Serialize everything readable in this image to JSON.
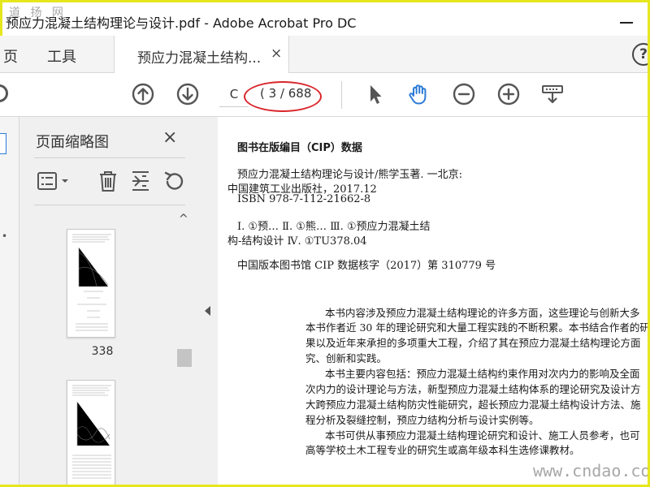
{
  "window": {
    "title": "预应力混凝土结构理论与设计.pdf - Adobe Acrobat Pro DC",
    "watermark_top": "道 扬 网"
  },
  "menubar": {
    "home_partial": "页",
    "tools": "工具",
    "tab_label": "预应力混凝土结构...",
    "tab_close": "×",
    "help": "?"
  },
  "toolbar": {
    "page_input_value": "C",
    "page_count": "( 3 / 688",
    "icons": [
      "search-icon",
      "arrow-up-circle-icon",
      "arrow-down-circle-icon",
      "pointer-icon",
      "hand-icon",
      "zoom-out-icon",
      "zoom-in-icon",
      "tools-icon"
    ],
    "accent_color": "#2b7bd6",
    "annotation_color": "#d9252a"
  },
  "thumbnail_panel": {
    "title": "页面缩略图",
    "close": "×",
    "tools": [
      "thumbnail-options-icon",
      "delete-icon",
      "extract-icon",
      "rotate-icon"
    ],
    "thumbnails": [
      {
        "page": "338"
      },
      {
        "page": ""
      }
    ]
  },
  "document": {
    "cip_title": "图书在版编目（CIP）数据",
    "cip_lines": [
      "预应力混凝土结构理论与设计/熊学玉著. 一北京:",
      "中国建筑工业出版社，2017.12",
      "ISBN 978-7-112-21662-8",
      "Ⅰ. ①预…   Ⅱ. ①熊…   Ⅲ. ①预应力混凝土结",
      "构-结构设计   Ⅳ. ①TU378.04",
      "中国版本图书馆 CIP 数据核字（2017）第 310779 号"
    ],
    "body_lines": [
      "本书内容涉及预应力混凝土结构理论的许多方面，这些理论与创新大多",
      "本书作者近 30 年的理论研究和大量工程实践的不断积累。本书结合作者的研",
      "果以及近年来承担的多项重大工程，介绍了其在预应力混凝土结构理论方面",
      "究、创新和实践。",
      "本书主要内容包括：预应力混凝土结构约束作用对次内力的影响及全面",
      "次内力的设计理论与方法，新型预应力混凝土结构体系的理论研究及设计方",
      "大跨预应力混凝土结构防灾性能研究，超长预应力混凝土结构设计方法、施",
      "程分析及裂缝控制，预应力结构分析与设计实例等。",
      "本书可供从事预应力混凝土结构理论研究和设计、施工人员参考，也可",
      "高等学校土木工程专业的研究生或高年级本科生选修课教材。"
    ]
  },
  "watermark_bottom": "www.cndao.com"
}
